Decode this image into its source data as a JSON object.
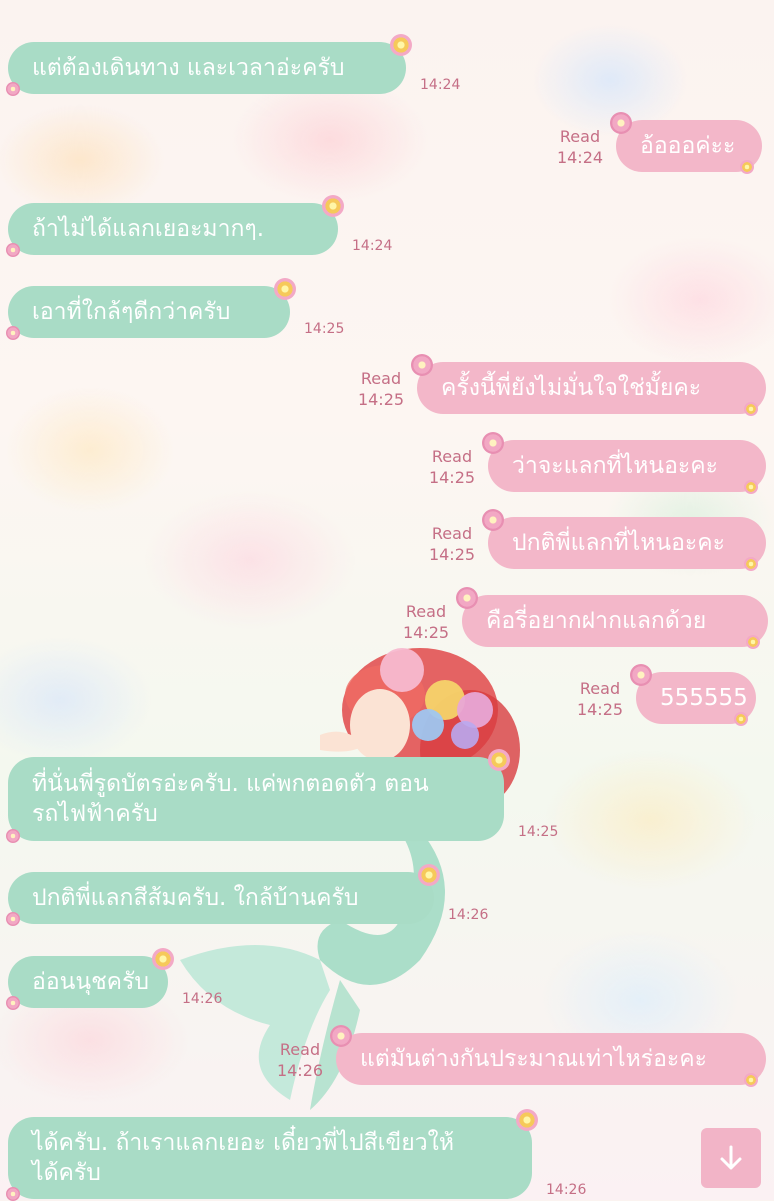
{
  "theme": {
    "incoming_bubble": "#a9dcc6",
    "outgoing_bubble": "#f3b7c9",
    "meta_text": "#c56f86"
  },
  "messages": [
    {
      "dir": "in",
      "text": "แต่ต้องเดินทาง และเวลาอ่ะครับ",
      "time": "14:24"
    },
    {
      "dir": "out",
      "text": "อ้อออค่ะะ",
      "time": "14:24",
      "status": "Read"
    },
    {
      "dir": "in",
      "text": "ถ้าไม่ได้แลกเยอะมากๆ.",
      "time": "14:24"
    },
    {
      "dir": "in",
      "text": "เอาที่ใกล้ๆดีกว่าครับ",
      "time": "14:25"
    },
    {
      "dir": "out",
      "text": "ครั้งนี้พี่ยังไม่มั่นใจใช่มั้ยคะ",
      "time": "14:25",
      "status": "Read"
    },
    {
      "dir": "out",
      "text": "ว่าจะแลกที่ไหนอะคะ",
      "time": "14:25",
      "status": "Read"
    },
    {
      "dir": "out",
      "text": "ปกติพี่แลกที่ไหนอะคะ",
      "time": "14:25",
      "status": "Read"
    },
    {
      "dir": "out",
      "text": "คือรี่อยากฝากแลกด้วย",
      "time": "14:25",
      "status": "Read"
    },
    {
      "dir": "out",
      "text": "555555",
      "time": "14:25",
      "status": "Read"
    },
    {
      "dir": "in",
      "lines": [
        "ที่นั่นพี่รูดบัตรอ่ะครับ. แค่พกตอดตัว ตอน",
        "รถไฟฟ้าครับ"
      ],
      "time": "14:25"
    },
    {
      "dir": "in",
      "text": "ปกติพี่แลกสีส้มครับ. ใกล้บ้านครับ",
      "time": "14:26"
    },
    {
      "dir": "in",
      "text": "อ่อนนุชครับ",
      "time": "14:26"
    },
    {
      "dir": "out",
      "text": "แต่มันต่างกันประมาณเท่าไหร่อะคะ",
      "time": "14:26",
      "status": "Read"
    },
    {
      "dir": "in",
      "lines": [
        "ได้ครับ. ถ้าเราแลกเยอะ เดี๋ยวพี่ไปสีเขียวให้",
        "ได้ครับ"
      ],
      "time": "14:26"
    }
  ],
  "scroll_button": {
    "icon": "arrow-down-icon"
  }
}
